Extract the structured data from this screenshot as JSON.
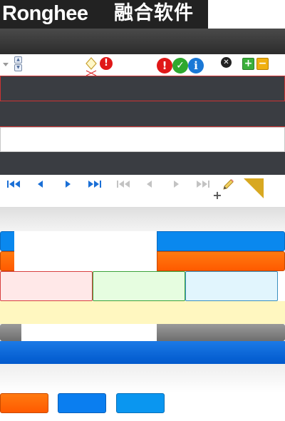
{
  "logo": {
    "latin_text": "Ronghee",
    "chinese_text": "融合软件"
  },
  "icons": {
    "dropdown_arrow": "triangle-down-icon",
    "spinner_up": "spinner-up-icon",
    "spinner_down": "spinner-down-icon",
    "diamond": "diamond-icon",
    "error": "error-icon",
    "success": "check-icon",
    "info": "info-icon",
    "close": "close-icon",
    "add": "plus-icon",
    "remove": "minus-icon",
    "edit": "pencil-icon",
    "add_small": "plus-icon",
    "corner": "corner-triangle-icon"
  },
  "pager": {
    "active": [
      "first-page-icon",
      "prev-page-icon",
      "next-page-icon",
      "last-page-icon"
    ],
    "disabled": [
      "first-page-icon",
      "prev-page-icon",
      "next-page-icon",
      "last-page-icon"
    ]
  },
  "colors": {
    "blue": "#0a88ee",
    "orange": "#ff6a00",
    "error_bg": "#ffe8e8",
    "success_bg": "#e6fde0",
    "info_bg": "#e1f5fd",
    "highlight": "#fff7c0",
    "gray": "#7f7f7f",
    "deep_blue": "#0063d6"
  }
}
